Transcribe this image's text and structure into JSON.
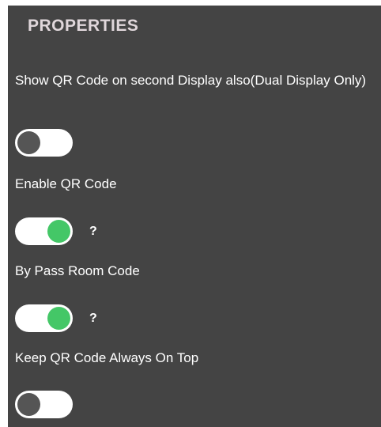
{
  "panel": {
    "title": "PROPERTIES"
  },
  "properties": [
    {
      "label": "Show QR Code on second Display also(Dual Display Only)",
      "enabled": false,
      "help": ""
    },
    {
      "label": "Enable QR Code",
      "enabled": true,
      "help": "?"
    },
    {
      "label": "By Pass Room Code",
      "enabled": true,
      "help": "?"
    },
    {
      "label": "Keep QR Code Always On Top",
      "enabled": false,
      "help": ""
    }
  ],
  "colors": {
    "panel_bg": "#444444",
    "toggle_on": "#44c767",
    "toggle_off_knob": "#555555",
    "title": "#e0d7db"
  },
  "icons": {
    "help": "question-mark-icon"
  }
}
